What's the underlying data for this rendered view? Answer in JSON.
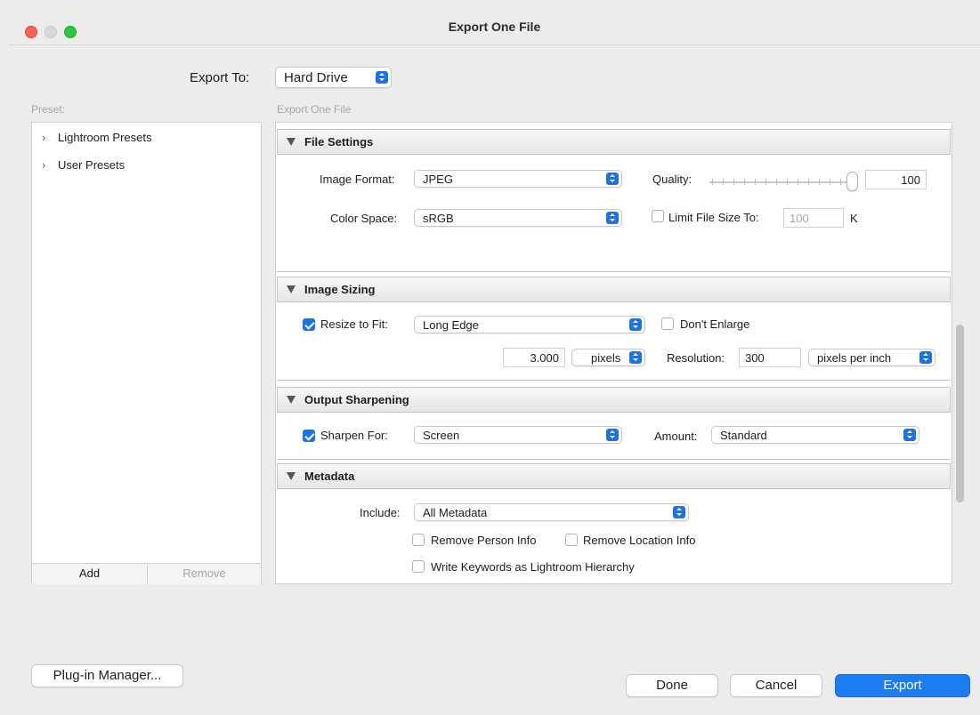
{
  "window": {
    "title": "Export One File"
  },
  "export_to": {
    "label": "Export To:",
    "value": "Hard Drive"
  },
  "preset_panel": {
    "heading": "Preset:",
    "items": [
      {
        "label": "Lightroom Presets"
      },
      {
        "label": "User Presets"
      }
    ],
    "add_label": "Add",
    "remove_label": "Remove"
  },
  "content_heading": "Export One File",
  "file_settings": {
    "title": "File Settings",
    "image_format_label": "Image Format:",
    "image_format_value": "JPEG",
    "quality_label": "Quality:",
    "quality_value": "100",
    "color_space_label": "Color Space:",
    "color_space_value": "sRGB",
    "limit_label": "Limit File Size To:",
    "limit_value": "100",
    "limit_unit": "K"
  },
  "image_sizing": {
    "title": "Image Sizing",
    "resize_label": "Resize to Fit:",
    "resize_value": "Long Edge",
    "dont_enlarge_label": "Don't Enlarge",
    "size_value": "3.000",
    "size_unit": "pixels",
    "resolution_label": "Resolution:",
    "resolution_value": "300",
    "resolution_unit": "pixels per inch"
  },
  "output_sharpening": {
    "title": "Output Sharpening",
    "sharpen_label": "Sharpen For:",
    "sharpen_value": "Screen",
    "amount_label": "Amount:",
    "amount_value": "Standard"
  },
  "metadata": {
    "title": "Metadata",
    "include_label": "Include:",
    "include_value": "All Metadata",
    "remove_person_label": "Remove Person Info",
    "remove_location_label": "Remove Location Info",
    "write_keywords_label": "Write Keywords as Lightroom Hierarchy"
  },
  "footer": {
    "plugin_manager_label": "Plug-in Manager...",
    "done_label": "Done",
    "cancel_label": "Cancel",
    "export_label": "Export"
  },
  "colors": {
    "accent": "#1c7cf2",
    "window_bg": "#ececec"
  }
}
